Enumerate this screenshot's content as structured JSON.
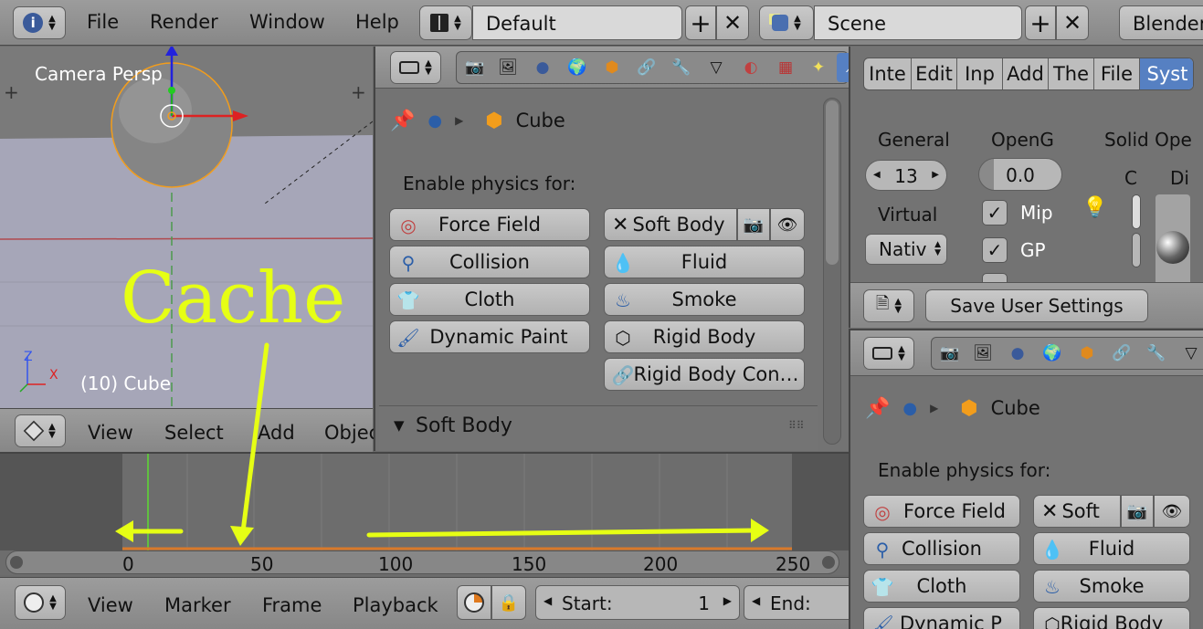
{
  "topbar": {
    "info_icon": "i",
    "menu": [
      "File",
      "Render",
      "Window",
      "Help"
    ],
    "screen_layout": "Default",
    "scene": "Scene",
    "engine": "Blender"
  },
  "viewport": {
    "label": "Camera Persp",
    "object_label": "(10) Cube",
    "axis_z": "Z",
    "axis_x": "X",
    "menu": [
      "View",
      "Select",
      "Add",
      "Objec"
    ]
  },
  "annotation": {
    "text": "Cache",
    "color": "#e6ff14"
  },
  "physics_panel": {
    "breadcrumb_object": "Cube",
    "enable_label": "Enable physics for:",
    "left_buttons": [
      "Force Field",
      "Collision",
      "Cloth",
      "Dynamic Paint"
    ],
    "right_buttons": [
      "Soft Body",
      "Fluid",
      "Smoke",
      "Rigid Body",
      "Rigid Body Con…"
    ],
    "section_title": "Soft Body"
  },
  "timeline": {
    "ticks": [
      "0",
      "50",
      "100",
      "150",
      "200",
      "250"
    ],
    "menu": [
      "View",
      "Marker",
      "Frame",
      "Playback"
    ],
    "start_label": "Start:",
    "start_value": "1",
    "end_label": "End:"
  },
  "user_prefs": {
    "tabs": [
      "Inte",
      "Edit",
      "Inp",
      "Add",
      "The",
      "File",
      "Syst"
    ],
    "active_tab": "Syst",
    "col1_label": "General",
    "col1_value": "13",
    "col1_label2": "Virtual",
    "col1_select": "Nativ",
    "col2_label": "OpenG",
    "col2_value": "0.0",
    "checks": [
      "Mip",
      "GP"
    ],
    "col3_label": "Solid Ope",
    "col3_sub1": "C",
    "col3_sub2": "Di",
    "save_button": "Save User Settings"
  },
  "physics_panel_2": {
    "breadcrumb_object": "Cube",
    "enable_label": "Enable physics for:",
    "left_buttons": [
      "Force Field",
      "Collision",
      "Cloth",
      "Dynamic P"
    ],
    "right_buttons": [
      "Soft",
      "Fluid",
      "Smoke",
      "Rigid Body"
    ]
  },
  "colors": {
    "accent_blue": "#5680c2",
    "object_orange": "#f29d1c",
    "timeline_current": "#60c040"
  }
}
